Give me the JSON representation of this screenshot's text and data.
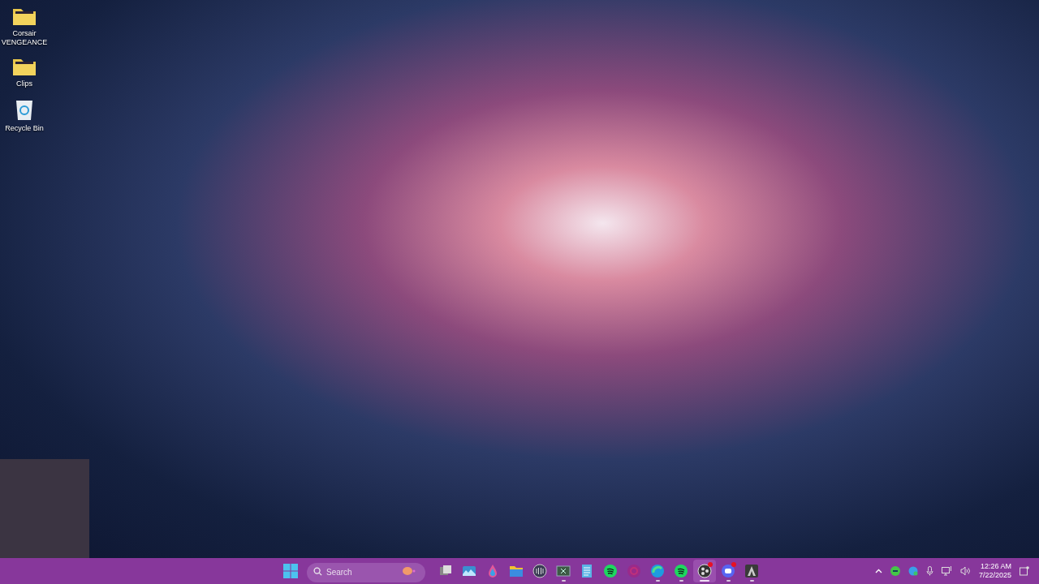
{
  "desktop_icons": [
    {
      "kind": "folder-image",
      "label": "Corsair VENGEANCE"
    },
    {
      "kind": "folder-image",
      "label": "Clips"
    },
    {
      "kind": "recycle-bin",
      "label": "Recycle Bin"
    }
  ],
  "taskbar": {
    "search": {
      "placeholder": "Search"
    },
    "apps": [
      {
        "kind": "task-view",
        "running": false,
        "selected": false,
        "badge": false
      },
      {
        "kind": "photos",
        "running": false,
        "selected": false,
        "badge": false
      },
      {
        "kind": "drop",
        "running": false,
        "selected": false,
        "badge": false
      },
      {
        "kind": "folder",
        "running": false,
        "selected": false,
        "badge": false
      },
      {
        "kind": "grid-circle",
        "running": false,
        "selected": false,
        "badge": false
      },
      {
        "kind": "sheet",
        "running": true,
        "selected": false,
        "badge": false
      },
      {
        "kind": "notepad",
        "running": false,
        "selected": false,
        "badge": false
      },
      {
        "kind": "music",
        "running": false,
        "selected": false,
        "badge": false
      },
      {
        "kind": "ring",
        "running": false,
        "selected": false,
        "badge": false
      },
      {
        "kind": "browser",
        "running": true,
        "selected": false,
        "badge": false
      },
      {
        "kind": "music",
        "running": true,
        "selected": false,
        "badge": false
      },
      {
        "kind": "recorder",
        "running": true,
        "selected": true,
        "badge": true
      },
      {
        "kind": "chat",
        "running": true,
        "selected": false,
        "badge": true
      },
      {
        "kind": "letter-a",
        "running": true,
        "selected": false,
        "badge": false
      }
    ]
  },
  "clock": {
    "time": "12:26 AM",
    "date": "7/22/2025"
  }
}
